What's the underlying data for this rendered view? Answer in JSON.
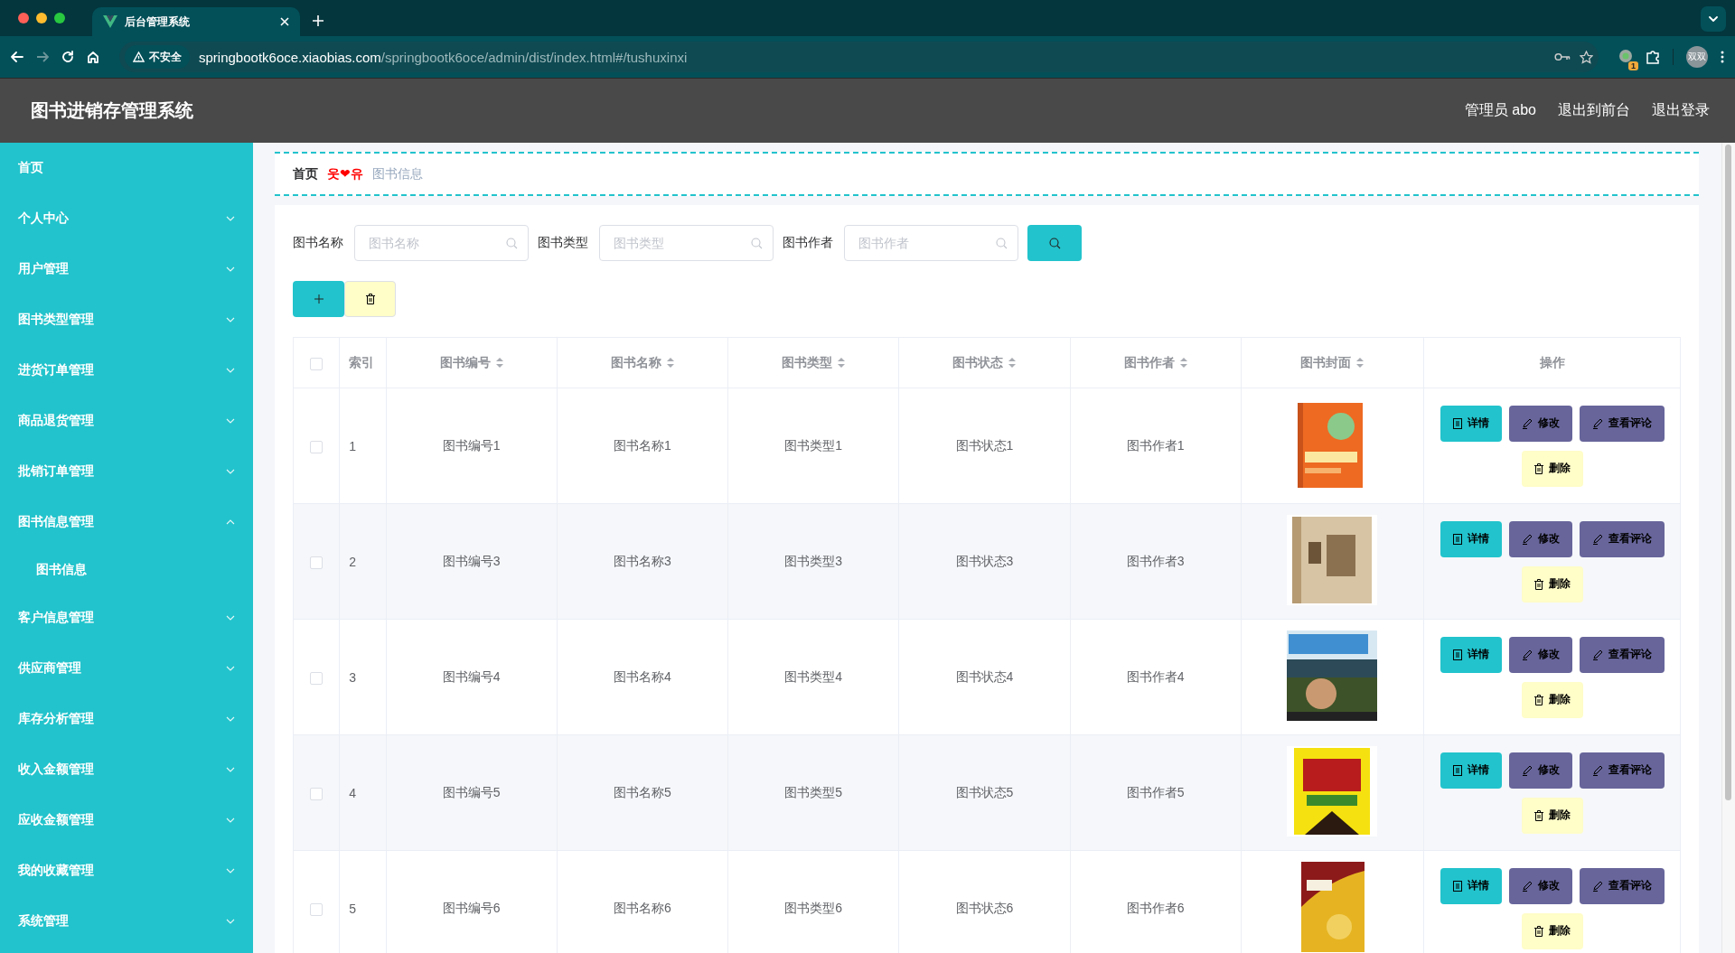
{
  "browser": {
    "tab_title": "后台管理系统",
    "security_label": "不安全",
    "url_host": "springbootk6oce.xiaobias.com",
    "url_path": "/springbootk6oce/admin/dist/index.html#/tushuxinxi",
    "extension_badge": "1",
    "profile": "双双"
  },
  "header": {
    "title": "图书进销存管理系统",
    "links": [
      "管理员 abo",
      "退出到前台",
      "退出登录"
    ]
  },
  "sidebar": {
    "items": [
      {
        "label": "首页"
      },
      {
        "label": "个人中心",
        "expanded": false
      },
      {
        "label": "用户管理",
        "expanded": false
      },
      {
        "label": "图书类型管理",
        "expanded": false
      },
      {
        "label": "进货订单管理",
        "expanded": false
      },
      {
        "label": "商品退货管理",
        "expanded": false
      },
      {
        "label": "批销订单管理",
        "expanded": false
      },
      {
        "label": "图书信息管理",
        "expanded": true,
        "children": [
          {
            "label": "图书信息"
          }
        ]
      },
      {
        "label": "客户信息管理",
        "expanded": false
      },
      {
        "label": "供应商管理",
        "expanded": false
      },
      {
        "label": "库存分析管理",
        "expanded": false
      },
      {
        "label": "收入金额管理",
        "expanded": false
      },
      {
        "label": "应收金额管理",
        "expanded": false
      },
      {
        "label": "我的收藏管理",
        "expanded": false
      },
      {
        "label": "系统管理",
        "expanded": false
      }
    ]
  },
  "breadcrumb": {
    "items": [
      "首页",
      "图书信息"
    ],
    "separator": "웃❤유"
  },
  "search": {
    "fields": [
      {
        "label": "图书名称",
        "placeholder": "图书名称"
      },
      {
        "label": "图书类型",
        "placeholder": "图书类型"
      },
      {
        "label": "图书作者",
        "placeholder": "图书作者"
      }
    ]
  },
  "table": {
    "all_checked": false,
    "columns": [
      {
        "label": "索引",
        "sortable": false
      },
      {
        "label": "图书编号",
        "sortable": true
      },
      {
        "label": "图书名称",
        "sortable": true
      },
      {
        "label": "图书类型",
        "sortable": true
      },
      {
        "label": "图书状态",
        "sortable": true
      },
      {
        "label": "图书作者",
        "sortable": true
      },
      {
        "label": "图书封面",
        "sortable": true
      },
      {
        "label": "操作",
        "sortable": false
      }
    ],
    "rows": [
      {
        "selected": false,
        "cells": [
          "1",
          "图书编号1",
          "图书名称1",
          "图书类型1",
          "图书状态1",
          "图书作者1"
        ],
        "cover": {
          "kind": "picture"
        },
        "actions": [
          {
            "kind": "detail",
            "label": "详情"
          },
          {
            "kind": "edit",
            "label": "修改"
          },
          {
            "kind": "comments",
            "label": "查看评论"
          },
          {
            "kind": "delete",
            "label": "删除"
          }
        ]
      },
      {
        "selected": false,
        "cells": [
          "2",
          "图书编号3",
          "图书名称3",
          "图书类型3",
          "图书状态3",
          "图书作者3"
        ],
        "cover": {
          "kind": "picture"
        },
        "actions": [
          {
            "kind": "detail",
            "label": "详情"
          },
          {
            "kind": "edit",
            "label": "修改"
          },
          {
            "kind": "comments",
            "label": "查看评论"
          },
          {
            "kind": "delete",
            "label": "删除"
          }
        ]
      },
      {
        "selected": false,
        "cells": [
          "3",
          "图书编号4",
          "图书名称4",
          "图书类型4",
          "图书状态4",
          "图书作者4"
        ],
        "cover": {
          "kind": "picture"
        },
        "actions": [
          {
            "kind": "detail",
            "label": "详情"
          },
          {
            "kind": "edit",
            "label": "修改"
          },
          {
            "kind": "comments",
            "label": "查看评论"
          },
          {
            "kind": "delete",
            "label": "删除"
          }
        ]
      },
      {
        "selected": false,
        "cells": [
          "4",
          "图书编号5",
          "图书名称5",
          "图书类型5",
          "图书状态5",
          "图书作者5"
        ],
        "cover": {
          "kind": "picture"
        },
        "actions": [
          {
            "kind": "detail",
            "label": "详情"
          },
          {
            "kind": "edit",
            "label": "修改"
          },
          {
            "kind": "comments",
            "label": "查看评论"
          },
          {
            "kind": "delete",
            "label": "删除"
          }
        ]
      },
      {
        "selected": false,
        "cells": [
          "5",
          "图书编号6",
          "图书名称6",
          "图书类型6",
          "图书状态6",
          "图书作者6"
        ],
        "cover": {
          "kind": "picture"
        },
        "actions": [
          {
            "kind": "detail",
            "label": "详情"
          },
          {
            "kind": "edit",
            "label": "修改"
          },
          {
            "kind": "comments",
            "label": "查看评论"
          },
          {
            "kind": "delete",
            "label": "删除"
          }
        ]
      }
    ]
  }
}
